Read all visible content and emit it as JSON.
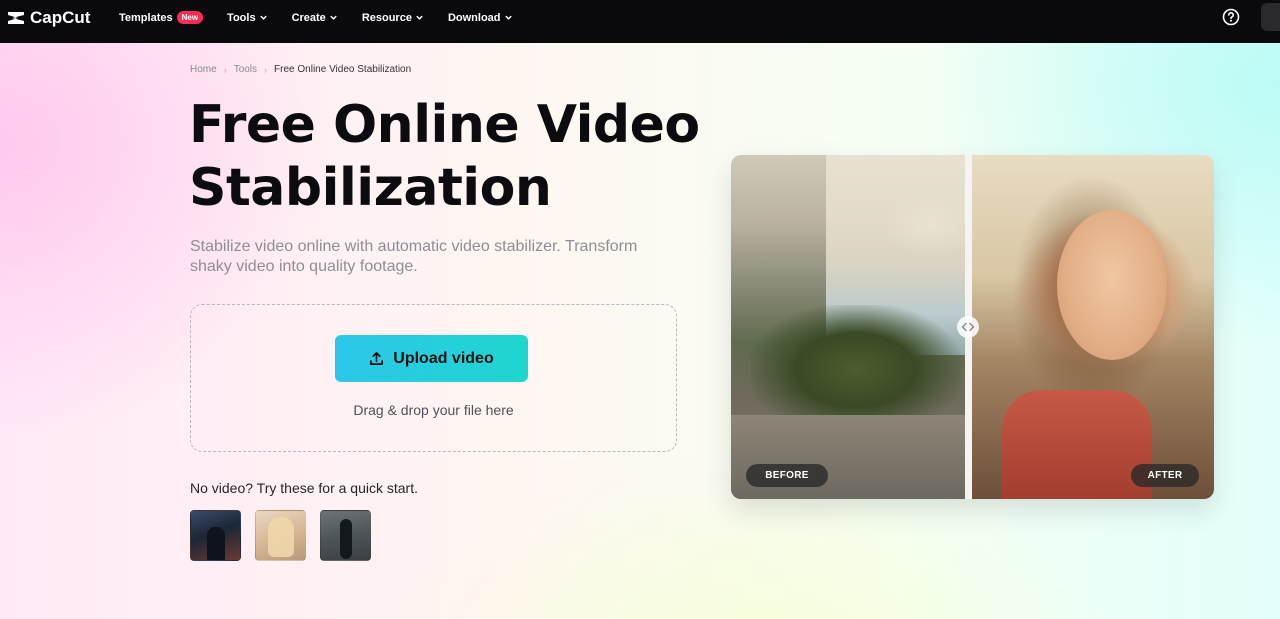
{
  "nav": {
    "brand": "CapCut",
    "items": [
      {
        "label": "Templates",
        "badge": "New",
        "has_chevron": false
      },
      {
        "label": "Tools",
        "has_chevron": true
      },
      {
        "label": "Create",
        "has_chevron": true
      },
      {
        "label": "Resource",
        "has_chevron": true
      },
      {
        "label": "Download",
        "has_chevron": true
      }
    ],
    "help_icon": "help-circle-icon"
  },
  "breadcrumb": {
    "items": [
      "Home",
      "Tools",
      "Free Online Video Stabilization"
    ]
  },
  "hero": {
    "title": "Free Online Video Stabilization",
    "subtitle": "Stabilize video online with automatic video stabilizer. Transform shaky video into quality footage."
  },
  "upload": {
    "button_label": "Upload video",
    "drag_text": "Drag & drop your file here"
  },
  "quick_start": {
    "label": "No video? Try these for a quick start."
  },
  "compare": {
    "before_label": "BEFORE",
    "after_label": "AFTER"
  },
  "colors": {
    "nav_bg": "#0a0a0c",
    "upload_gradient_start": "#2dc7e9",
    "upload_gradient_end": "#1fd6cf",
    "badge_red": "#fe2c55"
  }
}
